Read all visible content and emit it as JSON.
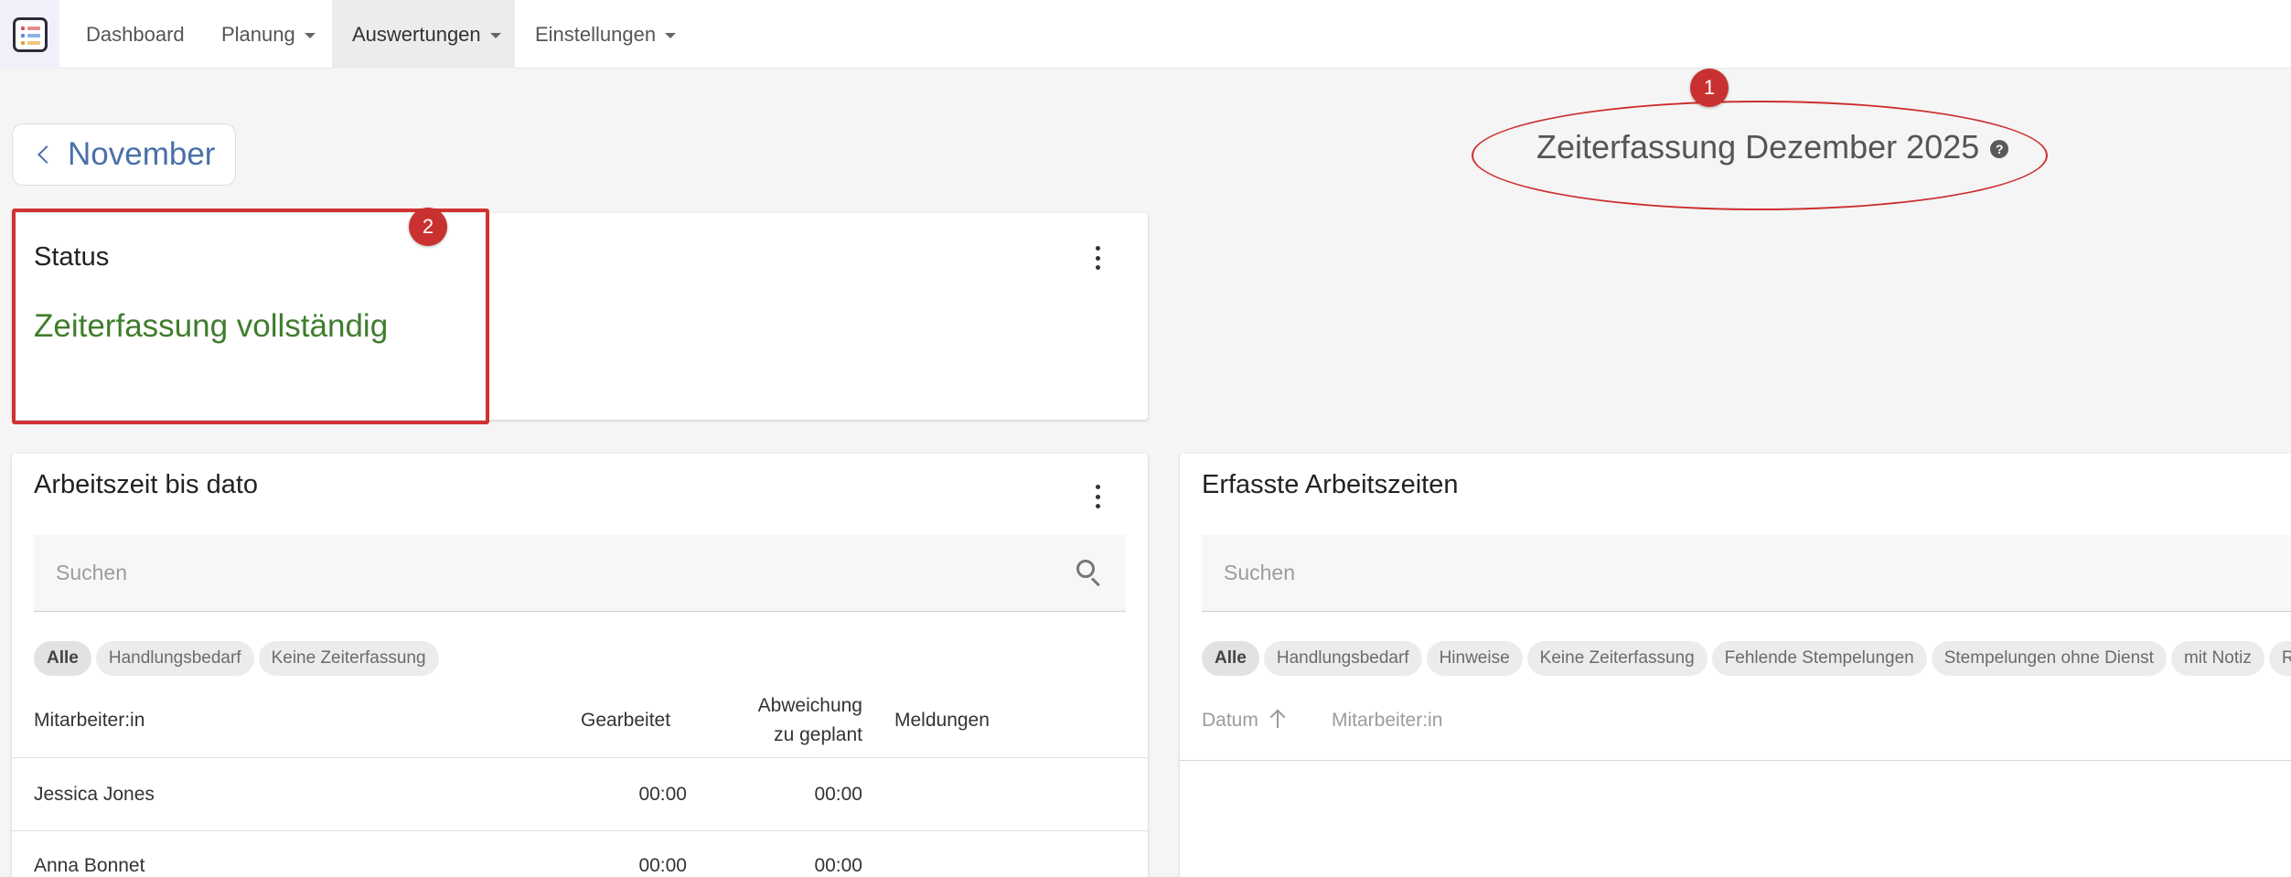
{
  "nav": {
    "items": [
      {
        "label": "Dashboard"
      },
      {
        "label": "Planung"
      },
      {
        "label": "Auswertungen"
      },
      {
        "label": "Einstellungen"
      }
    ]
  },
  "back_button": {
    "label": "November"
  },
  "page_title": {
    "text": "Zeiterfassung Dezember 2025",
    "help": "?"
  },
  "annotations": {
    "badge1": "1",
    "badge2": "2"
  },
  "status_card": {
    "title": "Status",
    "value": "Zeiterfassung vollständig"
  },
  "work_card": {
    "title": "Arbeitszeit bis dato",
    "search_placeholder": "Suchen",
    "chips": [
      "Alle",
      "Handlungsbedarf",
      "Keine Zeiterfassung"
    ],
    "columns": {
      "employee": "Mitarbeiter:in",
      "worked": "Gearbeitet",
      "deviation_line1": "Abweichung",
      "deviation_line2": "zu geplant",
      "messages": "Meldungen"
    },
    "rows": [
      {
        "name": "Jessica Jones",
        "worked": "00:00",
        "deviation": "00:00"
      },
      {
        "name": "Anna Bonnet",
        "worked": "00:00",
        "deviation": "00:00"
      }
    ]
  },
  "recorded_card": {
    "title": "Erfasste Arbeitszeiten",
    "search_placeholder": "Suchen",
    "chips": [
      "Alle",
      "Handlungsbedarf",
      "Hinweise",
      "Keine Zeiterfassung",
      "Fehlende Stempelungen",
      "Stempelungen ohne Dienst",
      "mit Notiz",
      "Ra"
    ],
    "columns": {
      "date": "Datum",
      "employee": "Mitarbeiter:in"
    }
  },
  "colors": {
    "accent_link": "#4a6fa8",
    "status_ok": "#3f7d2c",
    "annotation": "#c8312f"
  }
}
